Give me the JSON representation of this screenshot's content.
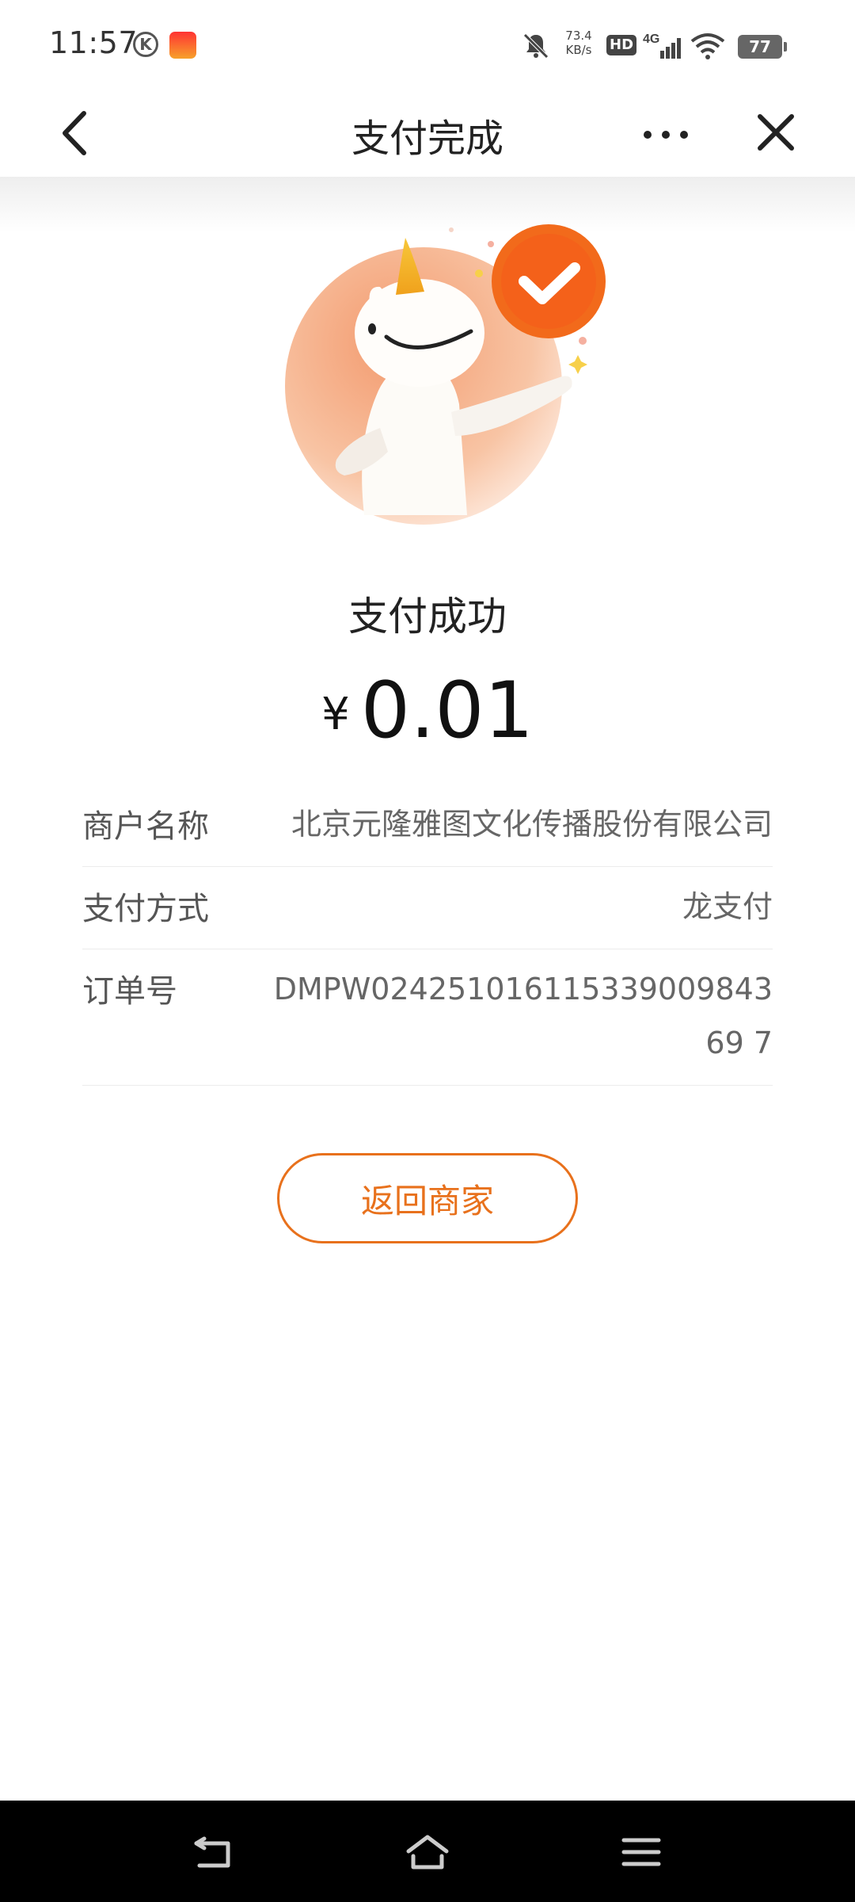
{
  "status_bar": {
    "time": "11:57",
    "k_badge": "K",
    "net_speed_value": "73.4",
    "net_speed_unit": "KB/s",
    "hd_label": "HD",
    "signal_label": "4G",
    "battery": "77"
  },
  "nav": {
    "title": "支付完成",
    "back_icon": "chevron-left-icon",
    "more_icon": "more-dots-icon",
    "close_icon": "close-icon"
  },
  "result": {
    "status_text": "支付成功",
    "currency_symbol": "¥",
    "amount": "0.01"
  },
  "details": [
    {
      "label": "商户名称",
      "value": "北京元隆雅图文化传播股份有限公司"
    },
    {
      "label": "支付方式",
      "value": "龙支付"
    },
    {
      "label": "订单号",
      "value": "DMPW02425101611533900984369 7"
    }
  ],
  "return_button": {
    "label": "返回商家"
  },
  "colors": {
    "accent": "#e8711c",
    "check_badge": "#f26a1b",
    "illustration_bg": "#f8b48c"
  }
}
